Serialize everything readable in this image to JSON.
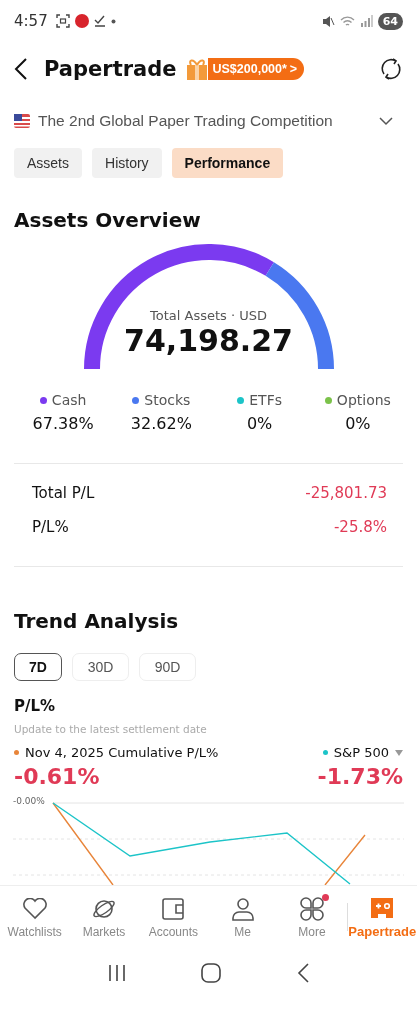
{
  "status_bar": {
    "time": "4:57",
    "battery": "64"
  },
  "header": {
    "title": "Papertrade",
    "promo": "US$200,000*",
    "promo_arrow": ">"
  },
  "competition": {
    "name": "The 2nd Global Paper Trading Competition"
  },
  "tabs": [
    {
      "label": "Assets",
      "selected": false
    },
    {
      "label": "History",
      "selected": false
    },
    {
      "label": "Performance",
      "selected": true
    }
  ],
  "overview": {
    "title": "Assets Overview",
    "total_label": "Total Assets · USD",
    "total": "74,198.27",
    "legend": [
      {
        "name": "Cash",
        "value": "67.38%",
        "color": "#7b3af0"
      },
      {
        "name": "Stocks",
        "value": "32.62%",
        "color": "#4a78f0"
      },
      {
        "name": "ETFs",
        "value": "0%",
        "color": "#1cc4c8"
      },
      {
        "name": "Options",
        "value": "0%",
        "color": "#7bc24a"
      }
    ]
  },
  "pl_rows": [
    {
      "label": "Total P/L",
      "value": "-25,801.73"
    },
    {
      "label": "P/L%",
      "value": "-25.8%"
    }
  ],
  "trend": {
    "title": "Trend Analysis",
    "periods": [
      {
        "label": "7D",
        "selected": true
      },
      {
        "label": "30D",
        "selected": false
      },
      {
        "label": "90D",
        "selected": false
      }
    ],
    "subtitle": "P/L%",
    "note": "Update to the latest settlement date",
    "series": [
      {
        "label": "Nov 4, 2025 Cumulative P/L%",
        "value": "-0.61%",
        "color": "#e8853a"
      },
      {
        "label": "S&P 500",
        "value": "-1.73%",
        "color": "#1cc4c8"
      }
    ],
    "axis_label": "-0.00%"
  },
  "nav": [
    {
      "label": "Watchlists",
      "selected": false,
      "badge": false
    },
    {
      "label": "Markets",
      "selected": false,
      "badge": false
    },
    {
      "label": "Accounts",
      "selected": false,
      "badge": false
    },
    {
      "label": "Me",
      "selected": false,
      "badge": false
    },
    {
      "label": "More",
      "selected": false,
      "badge": true
    },
    {
      "label": "Papertrade",
      "selected": true,
      "badge": false
    }
  ]
}
